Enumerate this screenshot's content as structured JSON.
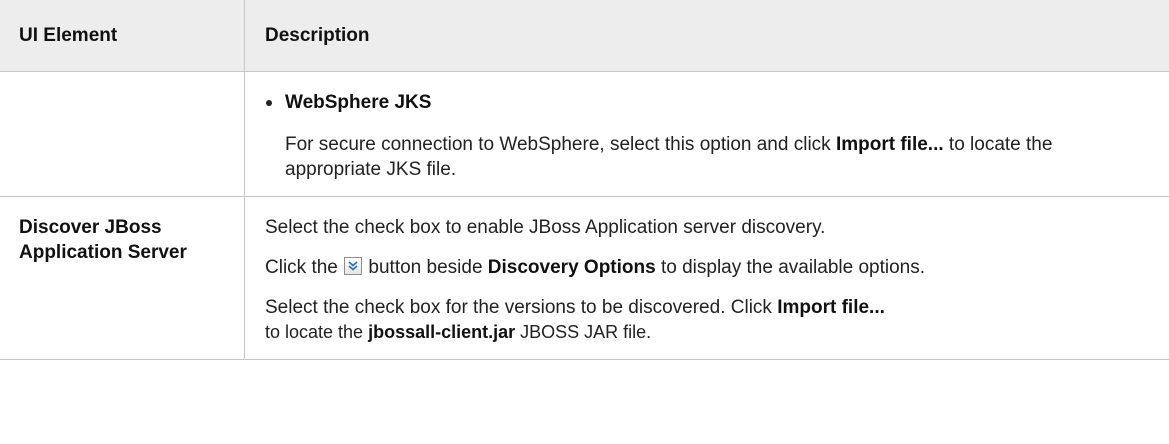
{
  "table": {
    "headers": {
      "ui_element": "UI Element",
      "description": "Description"
    },
    "rows": [
      {
        "ui_element": "",
        "bullet": "WebSphere JKS",
        "para1": {
          "pre": "For secure connection to WebSphere, select this option and click ",
          "bold": "Import file...",
          "post": " to locate the appropriate JKS file."
        }
      },
      {
        "ui_element": "Discover JBoss Application Server",
        "para1": "Select the check box to enable JBoss Application server discovery.",
        "para2": {
          "pre": "Click the ",
          "icon": "expand-chevron-icon",
          "mid": " button beside ",
          "bold": "Discovery Options",
          "post": " to display the available options."
        },
        "para3": {
          "pre": "Select the check box for the versions to be discovered. Click ",
          "bold": "Import file...",
          "pre2": "to locate the ",
          "bold2": "jbossall-client.jar",
          "post": " JBOSS JAR file."
        }
      }
    ]
  }
}
